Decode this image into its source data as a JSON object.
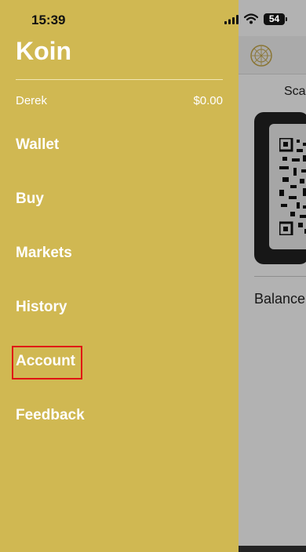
{
  "status_bar": {
    "time": "15:39",
    "battery": "54"
  },
  "drawer": {
    "title": "Koin",
    "user_name": "Derek",
    "balance": "$0.00",
    "menu": [
      {
        "label": "Wallet"
      },
      {
        "label": "Buy"
      },
      {
        "label": "Markets"
      },
      {
        "label": "History"
      },
      {
        "label": "Account"
      },
      {
        "label": "Feedback"
      }
    ]
  },
  "background": {
    "scan_label": "Sca",
    "balance_label": "Balance"
  },
  "colors": {
    "drawer_bg": "#d0b852",
    "highlight": "#e01414"
  }
}
